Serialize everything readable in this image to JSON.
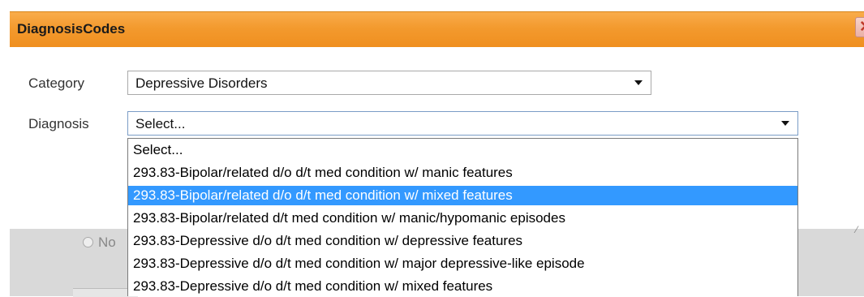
{
  "dialog": {
    "title": "DiagnosisCodes",
    "close_glyph": "✕"
  },
  "form": {
    "category_label": "Category",
    "category_value": "Depressive Disorders",
    "diagnosis_label": "Diagnosis",
    "diagnosis_value": "Select..."
  },
  "dropdown": {
    "options": [
      "Select...",
      "293.83-Bipolar/related d/o d/t med condition w/ manic features",
      "293.83-Bipolar/related d/o d/t med condition w/ mixed features",
      "293.83-Bipolar/related d/t med condition w/ manic/hypomanic episodes",
      "293.83-Depressive d/o d/t med condition w/ depressive features",
      "293.83-Depressive d/o d/t med condition w/ major depressive-like episode",
      "293.83-Depressive d/o d/t med condition w/ mixed features"
    ],
    "highlighted_index": 2,
    "highlight_color": "#3399ff"
  },
  "background": {
    "radio_label": "No"
  },
  "colors": {
    "title_bar": "#f39a2e"
  }
}
